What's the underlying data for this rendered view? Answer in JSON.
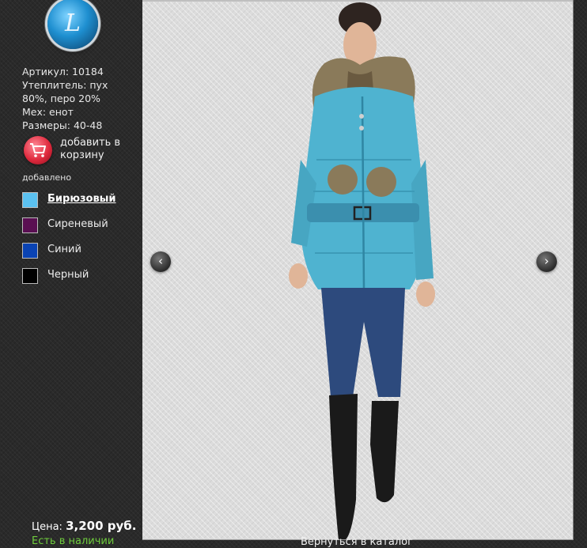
{
  "logo": {
    "glyph": "L"
  },
  "product": {
    "article": "Артикул: 10184",
    "insulation_1": "Утеплитель: пух",
    "insulation_2": "80%, перо 20%",
    "fur": "Мех: енот",
    "sizes": "Размеры: 40-48"
  },
  "cart": {
    "add_label": "добавить в корзину",
    "added_text": "добавлено"
  },
  "colors": [
    {
      "label": "Бирюзовый",
      "hex": "#5bc1f0",
      "active": true
    },
    {
      "label": "Сиреневый",
      "hex": "#5a0f52",
      "active": false
    },
    {
      "label": "Синий",
      "hex": "#0a43b3",
      "active": false
    },
    {
      "label": "Черный",
      "hex": "#000000",
      "active": false
    }
  ],
  "price": {
    "label": "Цена:",
    "value": "3,200 руб."
  },
  "stock": "Есть в наличии",
  "back_link": "Вернуться в каталог",
  "gallery": {
    "prev_icon": "‹",
    "next_icon": "›"
  }
}
